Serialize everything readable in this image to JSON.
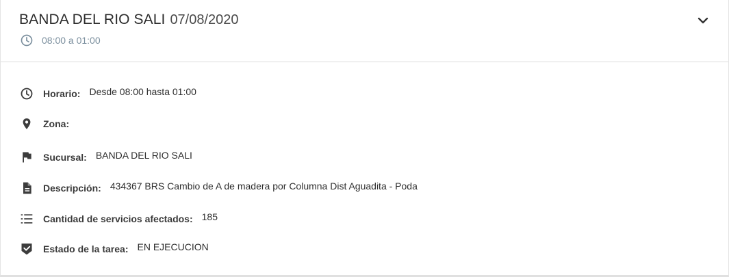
{
  "header": {
    "title": "BANDA DEL RIO SALI",
    "date": "07/08/2020",
    "subtitle": "08:00 a 01:00",
    "icons": {
      "subtitle": "clock-icon",
      "expand": "chevron-down-icon"
    }
  },
  "details": [
    {
      "icon": "clock-icon",
      "label": "Horario:",
      "value": "Desde 08:00 hasta 01:00"
    },
    {
      "icon": "location-pin-icon",
      "label": "Zona:",
      "value": ""
    },
    {
      "icon": "flag-icon",
      "label": "Sucursal:",
      "value": "BANDA DEL RIO SALI"
    },
    {
      "icon": "document-icon",
      "label": "Descripción:",
      "value": "434367 BRS Cambio de A de madera por Columna Dist Aguadita - Poda"
    },
    {
      "icon": "numbered-list-icon",
      "label": "Cantidad de servicios afectados:",
      "value": "185"
    },
    {
      "icon": "checked-shield-icon",
      "label": "Estado de la tarea:",
      "value": "EN EJECUCION"
    }
  ],
  "colors": {
    "subtitle_text": "#7b8f9e",
    "icon": "#3c3c3c",
    "divider": "#dcdcdc"
  }
}
